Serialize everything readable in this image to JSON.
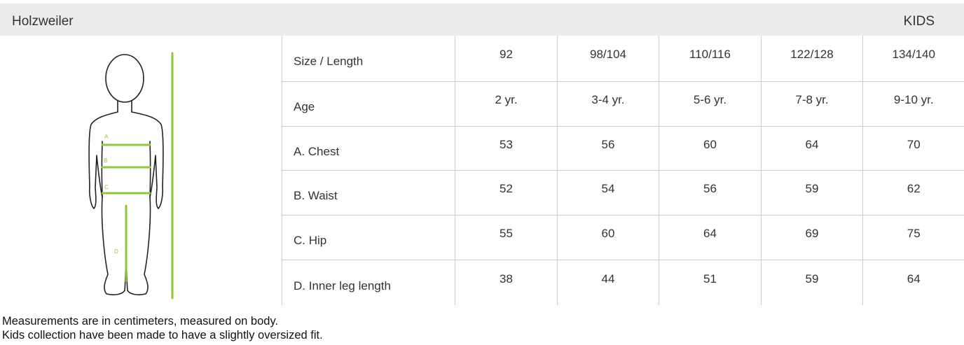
{
  "header": {
    "brand": "Holzweiler",
    "category": "KIDS"
  },
  "figure": {
    "labels": [
      "A",
      "B",
      "C",
      "D"
    ]
  },
  "table": {
    "columns": [
      "Size / Length",
      "92",
      "98/104",
      "110/116",
      "122/128",
      "134/140"
    ],
    "rows": [
      {
        "label": "Age",
        "values": [
          "2 yr.",
          "3-4 yr.",
          "5-6 yr.",
          "7-8 yr.",
          "9-10 yr."
        ]
      },
      {
        "label": "A. Chest",
        "values": [
          "53",
          "56",
          "60",
          "64",
          "70"
        ]
      },
      {
        "label": "B. Waist",
        "values": [
          "52",
          "54",
          "56",
          "59",
          "62"
        ]
      },
      {
        "label": "C. Hip",
        "values": [
          "55",
          "60",
          "64",
          "69",
          "75"
        ]
      },
      {
        "label": "D. Inner leg length",
        "values": [
          "38",
          "44",
          "51",
          "59",
          "64"
        ]
      }
    ]
  },
  "notes": [
    "Measurements are in centimeters, measured on body.",
    "Kids collection have been made to have a slightly oversized fit."
  ],
  "colors": {
    "accent": "#8dc63f",
    "header_bg": "#ececec"
  }
}
